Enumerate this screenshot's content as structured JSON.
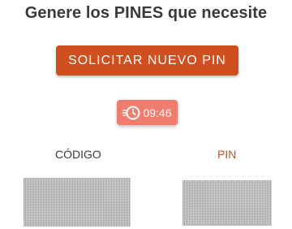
{
  "header": {
    "title": "Genere los PINES que necesite"
  },
  "actions": {
    "request_pin_label": "SOLICITAR NUEVO PIN"
  },
  "timer": {
    "icon": "clock-icon",
    "value": "09:46"
  },
  "columns": {
    "code_label": "CÓDIGO",
    "pin_label": "PIN"
  },
  "colors": {
    "accent": "#cf4f1f",
    "timer_bg": "#ee7d6d",
    "text": "#3a3a3a"
  }
}
